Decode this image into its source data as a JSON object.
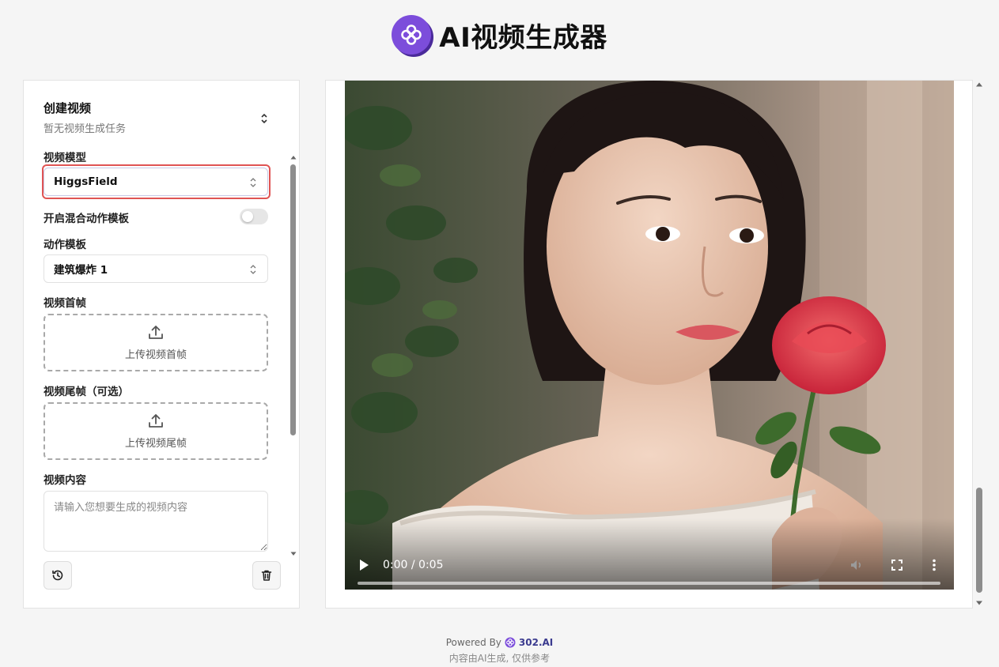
{
  "header": {
    "title": "AI视频生成器",
    "logo_icon": "flower-logo-icon"
  },
  "create": {
    "title": "创建视频",
    "subtitle": "暂无视频生成任务",
    "model_label": "视频模型",
    "model_value": "HiggsField",
    "mix_template_label": "开启混合动作模板",
    "mix_template_on": false,
    "template_label": "动作模板",
    "template_value": "建筑爆炸 1",
    "first_frame_label": "视频首帧",
    "first_frame_upload": "上传视频首帧",
    "last_frame_label": "视频尾帧（可选）",
    "last_frame_upload": "上传视频尾帧",
    "content_label": "视频内容",
    "content_placeholder": "请输入您想要生成的视频内容"
  },
  "video": {
    "time": "0:00 / 0:05",
    "progress": 0
  },
  "footer": {
    "powered_by": "Powered By",
    "brand": "302.AI",
    "disclaimer": "内容由AI生成, 仅供参考"
  },
  "colors": {
    "accent": "#7c4ddb",
    "highlight": "#e05454"
  }
}
